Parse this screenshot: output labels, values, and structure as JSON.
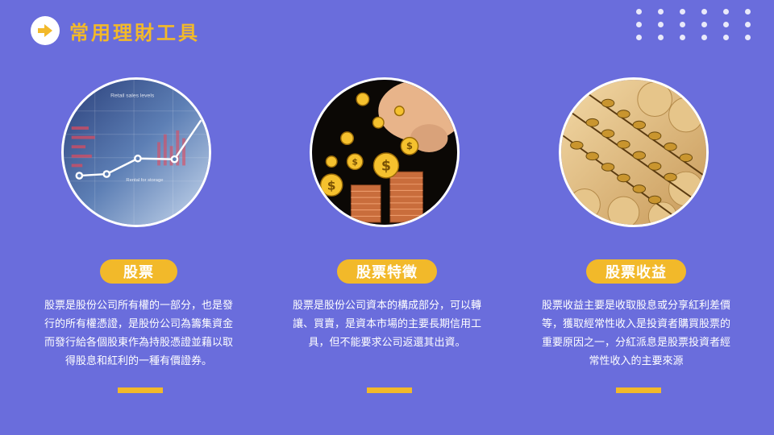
{
  "header": {
    "title": "常用理財工具",
    "icon": "arrow-right-icon"
  },
  "cards": [
    {
      "title": "股票",
      "description": "股票是股份公司所有權的一部分，也是發行的所有權憑證，是股份公司為籌集資金而發行給各個股東作為持股憑證並藉以取得股息和紅利的一種有價證券。",
      "image": {
        "label": "Retail sales levels",
        "caption": "Rental for storage"
      }
    },
    {
      "title": "股票特徵",
      "description": "股票是股份公司資本的構成部分，可以轉讓、買賣，是資本市場的主要長期信用工具，但不能要求公司返還其出資。",
      "image": {
        "coin_symbol": "$"
      }
    },
    {
      "title": "股票收益",
      "description": "股票收益主要是收取股息或分享紅利差價等，獲取經常性收入是投資者購買股票的重要原因之一，分紅派息是股票投資者經常性收入的主要來源",
      "image": {}
    }
  ],
  "colors": {
    "background": "#6a6ddc",
    "accent": "#f2b92a",
    "text": "#ffffff"
  }
}
